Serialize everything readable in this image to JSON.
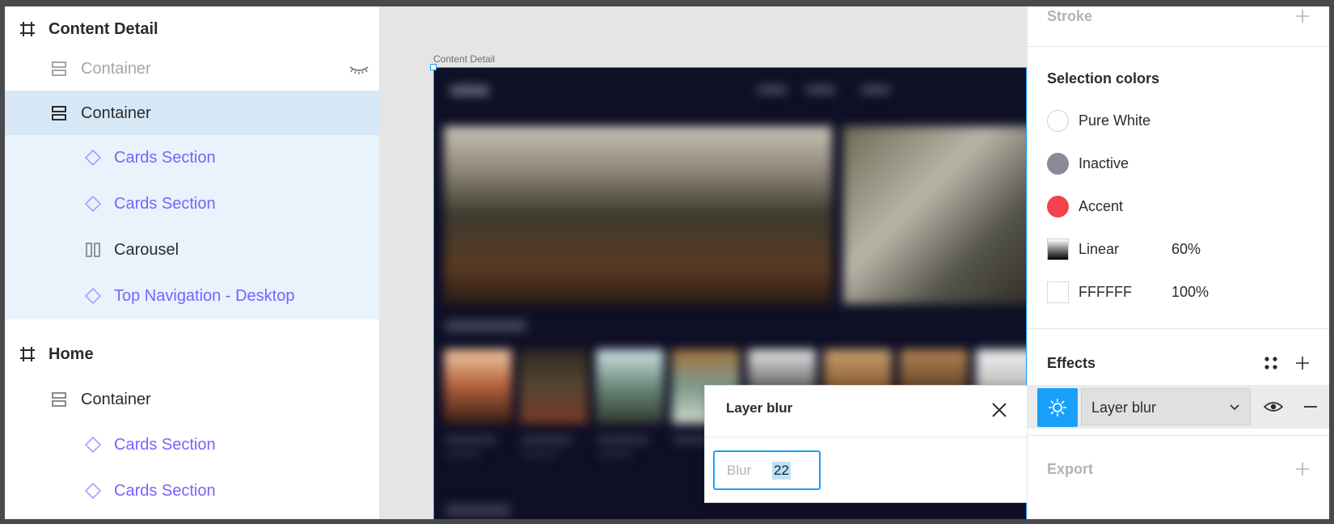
{
  "layers": [
    {
      "label": "Content Detail",
      "kind": "frame",
      "icon": "frame-hash-icon"
    },
    {
      "label": "Container",
      "kind": "autolayout",
      "icon": "autolayout-vertical-icon",
      "hidden": true
    },
    {
      "label": "Container",
      "kind": "autolayout",
      "icon": "autolayout-vertical-icon",
      "selected": true
    },
    {
      "label": "Cards Section",
      "kind": "component",
      "icon": "instance-diamond-icon"
    },
    {
      "label": "Cards Section",
      "kind": "component",
      "icon": "instance-diamond-icon"
    },
    {
      "label": "Carousel",
      "kind": "autolayout-h",
      "icon": "autolayout-horizontal-icon"
    },
    {
      "label": "Top Navigation - Desktop",
      "kind": "component",
      "icon": "instance-diamond-icon"
    },
    {
      "label": "Home",
      "kind": "frame",
      "icon": "frame-hash-icon"
    },
    {
      "label": "Container",
      "kind": "autolayout",
      "icon": "autolayout-vertical-icon"
    },
    {
      "label": "Cards Section",
      "kind": "component",
      "icon": "instance-diamond-icon"
    },
    {
      "label": "Cards Section",
      "kind": "component",
      "icon": "instance-diamond-icon"
    }
  ],
  "canvas": {
    "frame_label": "Content Detail"
  },
  "popover": {
    "title": "Layer blur",
    "field_label": "Blur",
    "field_value": "22"
  },
  "props": {
    "stroke_title": "Stroke",
    "selection_colors_title": "Selection colors",
    "colors": [
      {
        "name": "Pure White",
        "pct": "",
        "swatch": "#ffffff",
        "shape": "circle"
      },
      {
        "name": "Inactive",
        "pct": "",
        "swatch": "#8a8a96",
        "shape": "circle"
      },
      {
        "name": "Accent",
        "pct": "",
        "swatch": "#f2414f",
        "shape": "circle"
      },
      {
        "name": "Linear",
        "pct": "60%",
        "swatch": "gradient",
        "shape": "square"
      },
      {
        "name": "FFFFFF",
        "pct": "100%",
        "swatch": "#ffffff",
        "shape": "square"
      }
    ],
    "effects_title": "Effects",
    "effect_type": "Layer blur",
    "export_title": "Export"
  },
  "colors": {
    "accent_blue": "#18a0fb",
    "component_purple": "#7b61ff",
    "artboard_bg": "#0f0f26"
  }
}
